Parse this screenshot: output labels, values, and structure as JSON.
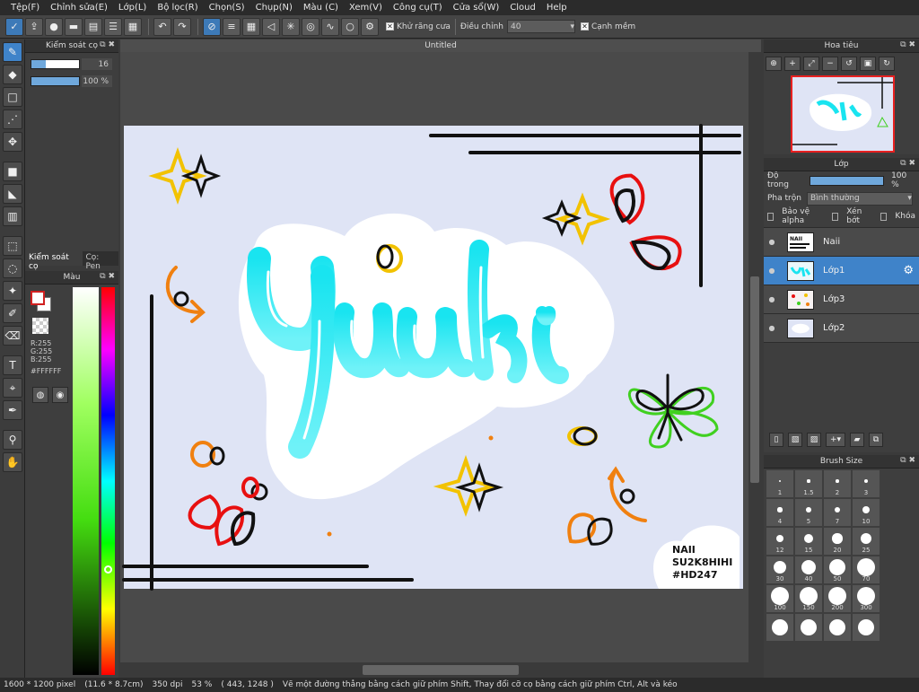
{
  "menu": [
    "Tệp(F)",
    "Chỉnh sửa(E)",
    "Lớp(L)",
    "Bộ lọc(R)",
    "Chọn(S)",
    "Chụp(N)",
    "Màu (C)",
    "Xem(V)",
    "Công cụ(T)",
    "Cửa sổ(W)",
    "Cloud",
    "Help"
  ],
  "toolbar": {
    "antialias_label": "Khử răng cưa",
    "correction_label": "Điều chỉnh",
    "correction_value": "40",
    "soft_edge_label": "Cạnh mềm"
  },
  "brush_control": {
    "title": "Kiểm soát cọ",
    "size_value": "16",
    "size_fraction": 0.3,
    "opacity_value": "100 %",
    "opacity_fraction": 1.0
  },
  "panel_tabs": [
    "Kiểm soát cọ",
    "Cọ: Pen"
  ],
  "color_panel": {
    "title": "Màu",
    "r": "R:255",
    "g": "G:255",
    "b": "B:255",
    "hex": "#FFFFFF"
  },
  "document": {
    "title": "Untitled",
    "artwork_text": "Yuuki",
    "credit_lines": [
      "NAII",
      "SU2K8HIHI",
      "#HD247"
    ]
  },
  "navigator": {
    "title": "Hoa tiêu"
  },
  "layers": {
    "title": "Lớp",
    "opacity_label": "Độ trong",
    "opacity_value": "100 %",
    "opacity_fraction": 1.0,
    "blend_label": "Pha trộn",
    "blend_value": "Bình thường",
    "protect_alpha_label": "Bảo vệ alpha",
    "clipping_label": "Xén bớt",
    "lock_label": "Khóa",
    "items": [
      {
        "name": "Naii",
        "selected": false
      },
      {
        "name": "Lớp1",
        "selected": true
      },
      {
        "name": "Lớp3",
        "selected": false
      },
      {
        "name": "Lớp2",
        "selected": false
      }
    ]
  },
  "brush_size": {
    "title": "Brush Size",
    "sizes": [
      "1",
      "1.5",
      "2",
      "3",
      "4",
      "5",
      "7",
      "10",
      "12",
      "15",
      "20",
      "25",
      "30",
      "40",
      "50",
      "70",
      "100",
      "150",
      "200",
      "300",
      "",
      "",
      "",
      ""
    ]
  },
  "status": {
    "dimensions": "1600 * 1200 pixel",
    "physical": "(11.6 * 8.7cm)",
    "dpi": "350 dpi",
    "zoom": "53 %",
    "coords": "( 443, 1248 )",
    "hint": "Vẽ một đường thẳng bằng cách giữ phím Shift, Thay đổi cỡ cọ bằng cách giữ phím Ctrl, Alt và kéo"
  },
  "colors": {
    "accent": "#3f83c9",
    "canvas_bg": "#dfe4f5"
  }
}
